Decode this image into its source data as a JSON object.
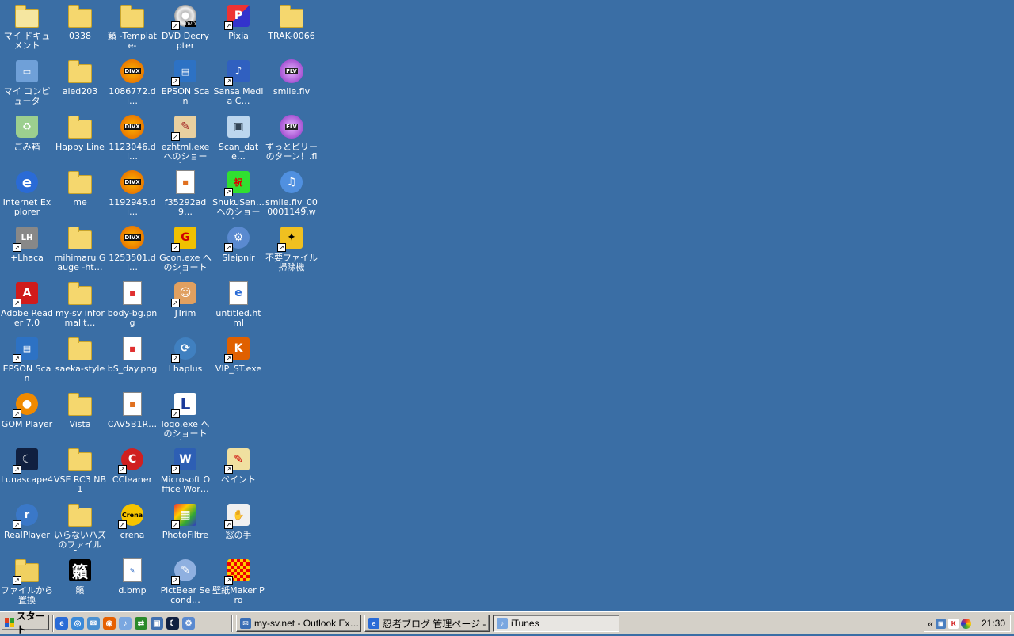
{
  "desktop": {
    "background": "#3a6ea5",
    "columns": [
      [
        {
          "label": "マイ ドキュメント",
          "icon": "my-documents-icon",
          "kind": "folder-doc"
        },
        {
          "label": "マイ コンピュータ",
          "icon": "my-computer-icon",
          "kind": "computer"
        },
        {
          "label": "ごみ箱",
          "icon": "recycle-bin-icon",
          "kind": "recycle"
        },
        {
          "label": "Internet Explorer",
          "icon": "internet-explorer-icon",
          "kind": "ie"
        },
        {
          "label": "+Lhaca",
          "icon": "lhaca-icon",
          "kind": "app",
          "shortcut": true
        },
        {
          "label": "Adobe Reader 7.0",
          "icon": "adobe-reader-icon",
          "kind": "adobe",
          "shortcut": true
        },
        {
          "label": "EPSON Scan",
          "icon": "epson-scan-icon",
          "kind": "scanner",
          "shortcut": true
        },
        {
          "label": "GOM Player",
          "icon": "gom-player-icon",
          "kind": "gom",
          "shortcut": true
        },
        {
          "label": "Lunascape4",
          "icon": "lunascape-icon",
          "kind": "luna",
          "shortcut": true
        },
        {
          "label": "RealPlayer",
          "icon": "realplayer-icon",
          "kind": "real",
          "shortcut": true
        },
        {
          "label": "ファイルから置換",
          "icon": "file-replace-icon",
          "kind": "replace",
          "shortcut": true
        }
      ],
      [
        {
          "label": "0338",
          "icon": "folder-icon",
          "kind": "folder"
        },
        {
          "label": "aled203",
          "icon": "folder-icon",
          "kind": "folder"
        },
        {
          "label": "Happy Line",
          "icon": "folder-icon",
          "kind": "folder"
        },
        {
          "label": "me",
          "icon": "folder-icon",
          "kind": "folder"
        },
        {
          "label": "mihimaru Gauge -ht…",
          "icon": "folder-icon",
          "kind": "folder"
        },
        {
          "label": "my-sv informalit…",
          "icon": "folder-icon",
          "kind": "folder"
        },
        {
          "label": "saeka-style",
          "icon": "folder-icon",
          "kind": "folder"
        },
        {
          "label": "Vista",
          "icon": "folder-icon",
          "kind": "folder"
        },
        {
          "label": "VSE RC3 NB1",
          "icon": "folder-icon",
          "kind": "folder"
        },
        {
          "label": "いらないハズのファイル&…",
          "icon": "folder-icon",
          "kind": "folder"
        },
        {
          "label": "籟",
          "icon": "kanji-icon",
          "kind": "kanji"
        }
      ],
      [
        {
          "label": "籟 -Template-",
          "icon": "folder-icon",
          "kind": "folder"
        },
        {
          "label": "1086772.di…",
          "icon": "divx-icon",
          "kind": "divx"
        },
        {
          "label": "1123046.di…",
          "icon": "divx-icon",
          "kind": "divx"
        },
        {
          "label": "1192945.di…",
          "icon": "divx-icon",
          "kind": "divx"
        },
        {
          "label": "1253501.di…",
          "icon": "divx-icon",
          "kind": "divx"
        },
        {
          "label": "body-bg.png",
          "icon": "png-file-icon",
          "kind": "png"
        },
        {
          "label": "bS_day.png",
          "icon": "png-file-icon",
          "kind": "png"
        },
        {
          "label": "CAV5B1R…",
          "icon": "image-file-icon",
          "kind": "file"
        },
        {
          "label": "CCleaner",
          "icon": "ccleaner-icon",
          "kind": "ccleaner",
          "shortcut": true
        },
        {
          "label": "crena",
          "icon": "crena-icon",
          "kind": "crena",
          "shortcut": true
        },
        {
          "label": "d.bmp",
          "icon": "bmp-file-icon",
          "kind": "bmp"
        }
      ],
      [
        {
          "label": "DVD Decrypter",
          "icon": "dvd-decrypter-icon",
          "kind": "dvd",
          "shortcut": true
        },
        {
          "label": "EPSON Scan",
          "icon": "epson-scan-icon",
          "kind": "scanner",
          "shortcut": true
        },
        {
          "label": "ezhtml.exe へのショート…",
          "icon": "ezhtml-icon",
          "kind": "ezhtml",
          "shortcut": true
        },
        {
          "label": "f35292ad9…",
          "icon": "image-file-icon",
          "kind": "file"
        },
        {
          "label": "Gcon.exe へのショートカ…",
          "icon": "gcon-icon",
          "kind": "gcon",
          "shortcut": true
        },
        {
          "label": "JTrim",
          "icon": "jtrim-icon",
          "kind": "jtrim",
          "shortcut": true
        },
        {
          "label": "Lhaplus",
          "icon": "lhaplus-icon",
          "kind": "lhaplus",
          "shortcut": true
        },
        {
          "label": "logo.exe へのショートカ…",
          "icon": "logo-exe-icon",
          "kind": "logo",
          "shortcut": true
        },
        {
          "label": "Microsoft Office Wor…",
          "icon": "word-icon",
          "kind": "word",
          "shortcut": true
        },
        {
          "label": "PhotoFiltre",
          "icon": "photofiltre-icon",
          "kind": "photofiltre",
          "shortcut": true
        },
        {
          "label": "PictBear Second…",
          "icon": "pictbear-icon",
          "kind": "pictbear",
          "shortcut": true
        }
      ],
      [
        {
          "label": "Pixia",
          "icon": "pixia-icon",
          "kind": "pixia",
          "shortcut": true
        },
        {
          "label": "Sansa Media C…",
          "icon": "sansa-icon",
          "kind": "sansa",
          "shortcut": true
        },
        {
          "label": "Scan_date…",
          "icon": "scan-folder-icon",
          "kind": "scanfile"
        },
        {
          "label": "ShukuSen… へのショート…",
          "icon": "shukusen-icon",
          "kind": "shukusen",
          "shortcut": true
        },
        {
          "label": "Sleipnir",
          "icon": "sleipnir-icon",
          "kind": "sleipnir",
          "shortcut": true
        },
        {
          "label": "untitled.html",
          "icon": "html-file-icon",
          "kind": "ie-file"
        },
        {
          "label": "VIP_ST.exe",
          "icon": "vip-st-icon",
          "kind": "vip",
          "shortcut": true
        },
        null,
        {
          "label": "ペイント",
          "icon": "paint-icon",
          "kind": "paint",
          "shortcut": true
        },
        {
          "label": "窓の手",
          "icon": "madonote-icon",
          "kind": "madonote",
          "shortcut": true
        },
        {
          "label": "壁紙Maker Pro",
          "icon": "wallpaper-maker-icon",
          "kind": "wallpaper",
          "shortcut": true
        }
      ],
      [
        {
          "label": "TRAK-0066",
          "icon": "folder-icon",
          "kind": "folder"
        },
        {
          "label": "smile.flv",
          "icon": "flv-icon",
          "kind": "flv"
        },
        {
          "label": "ずっとピリーのターン！.flv",
          "icon": "flv-icon",
          "kind": "flv"
        },
        {
          "label": "smile.flv_000001149.wav",
          "icon": "wav-file-icon",
          "kind": "wav"
        },
        {
          "label": "不要ファイル掃除機",
          "icon": "cleaner-icon",
          "kind": "cleaner",
          "shortcut": true
        }
      ]
    ]
  },
  "taskbar": {
    "start_label": "スタート",
    "quick_launch": [
      "ie-icon",
      "outlook-icon",
      "mail-icon",
      "firefox-icon",
      "itunes-icon",
      "network-icon",
      "screen-icon",
      "lunascape-icon",
      "sleipnir-icon"
    ],
    "tasks": [
      {
        "label": "my-sv.net - Outlook Ex…",
        "icon": "outlook-express-icon",
        "active": false
      },
      {
        "label": "忍者ブログ 管理ページ - …",
        "icon": "ie-icon",
        "active": false
      },
      {
        "label": "iTunes",
        "icon": "itunes-icon",
        "active": true
      }
    ],
    "tray_expand": "«",
    "clock": "21:30"
  }
}
